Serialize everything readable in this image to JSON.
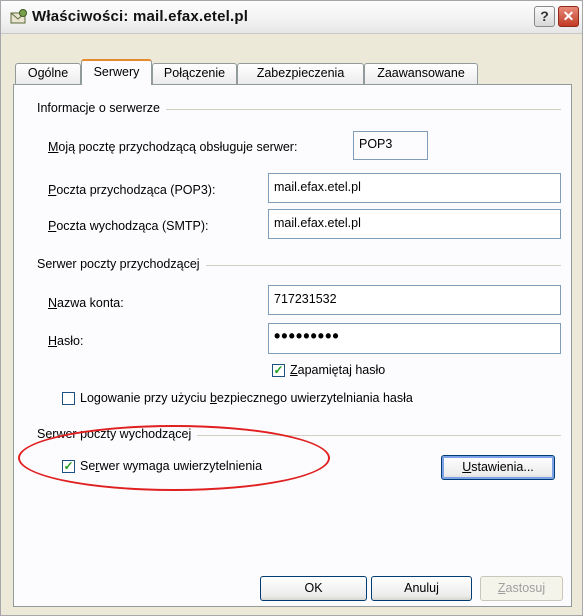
{
  "window": {
    "title": "Właściwości: mail.efax.etel.pl",
    "help_glyph": "?",
    "close_glyph": "✕"
  },
  "tabs": [
    {
      "label": "Ogólne",
      "active": false
    },
    {
      "label": "Serwery",
      "active": true
    },
    {
      "label": "Połączenie",
      "active": false
    },
    {
      "label": "Zabezpieczenia",
      "active": false
    },
    {
      "label": "Zaawansowane",
      "active": false
    }
  ],
  "server_info": {
    "group_label": "Informacje o serwerze",
    "incoming_type_label": "Moją pocztę przychodzącą obsługuje serwer:",
    "incoming_type_value": "POP3",
    "pop3_label": "Poczta przychodząca (POP3):",
    "pop3_value": "mail.efax.etel.pl",
    "smtp_label": "Poczta wychodząca (SMTP):",
    "smtp_value": "mail.efax.etel.pl"
  },
  "incoming": {
    "group_label": "Serwer poczty przychodzącej",
    "account_label": "Nazwa konta:",
    "account_value": "717231532",
    "password_label": "Hasło:",
    "password_value": "•••••••••",
    "remember_label": "Zapamiętaj hasło",
    "remember_checked": true,
    "spa_label": "Logowanie przy użyciu bezpiecznego uwierzytelniania hasła",
    "spa_checked": false
  },
  "outgoing": {
    "group_label": "Serwer poczty wychodzącej",
    "auth_label": "Serwer wymaga uwierzytelnienia",
    "auth_checked": true,
    "settings_button": "Ustawienia..."
  },
  "buttons": {
    "ok": "OK",
    "cancel": "Anuluj",
    "apply": "Zastosuj"
  },
  "colors": {
    "annotation_ellipse": "#e02020",
    "active_tab_accent": "#e68b2c",
    "close_button": "#c13a24"
  }
}
